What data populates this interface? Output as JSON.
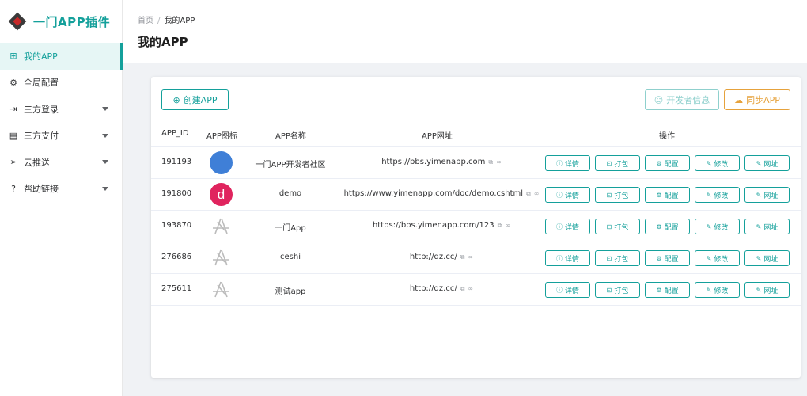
{
  "brand": {
    "title": "一门APP插件"
  },
  "sidebar": {
    "items": [
      {
        "label": "我的APP",
        "icon": "grid-icon"
      },
      {
        "label": "全局配置",
        "icon": "settings-icon"
      },
      {
        "label": "三方登录",
        "icon": "login-icon"
      },
      {
        "label": "三方支付",
        "icon": "payment-icon"
      },
      {
        "label": "云推送",
        "icon": "send-icon"
      },
      {
        "label": "帮助链接",
        "icon": "help-icon"
      }
    ]
  },
  "breadcrumb": {
    "home": "首页",
    "separator": "/",
    "current": "我的APP"
  },
  "page": {
    "title": "我的APP"
  },
  "toolbar": {
    "create": "创建APP",
    "developer": "开发者信息",
    "sync": "同步APP"
  },
  "table": {
    "headers": {
      "id": "APP_ID",
      "icon": "APP图标",
      "name": "APP名称",
      "url": "APP网址",
      "ops": "操作"
    },
    "actions": [
      "详情",
      "打包",
      "配置",
      "修改",
      "网址"
    ],
    "rows": [
      {
        "id": "191193",
        "avatar": "blue",
        "name": "一门APP开发者社区",
        "url": "https://bbs.yimenapp.com"
      },
      {
        "id": "191800",
        "avatar": "red",
        "avatar_text": "d",
        "name": "demo",
        "url": "https://www.yimenapp.com/doc/demo.cshtml"
      },
      {
        "id": "193870",
        "avatar": "placeholder",
        "name": "一门App",
        "url": "https://bbs.yimenapp.com/123"
      },
      {
        "id": "276686",
        "avatar": "placeholder",
        "name": "ceshi",
        "url": "http://dz.cc/"
      },
      {
        "id": "275611",
        "avatar": "placeholder",
        "name": "测试app",
        "url": "http://dz.cc/"
      }
    ]
  },
  "colors": {
    "accent": "#14a09b",
    "warning": "#e6a23c",
    "accent_light": "#8fd0cd"
  }
}
